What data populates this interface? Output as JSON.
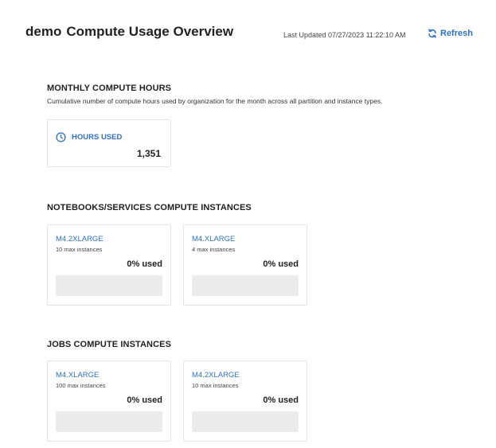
{
  "header": {
    "org": "demo",
    "title": "Compute Usage Overview",
    "last_updated": "Last Updated 07/27/2023 11:22:10 AM",
    "refresh_label": "Refresh"
  },
  "monthly": {
    "title": "MONTHLY COMPUTE HOURS",
    "description": "Cumulative number of compute hours used by organization for the month across all partition and instance types.",
    "hours_label": "HOURS USED",
    "hours_value": "1,351"
  },
  "notebooks": {
    "title": "NOTEBOOKS/SERVICES COMPUTE INSTANCES",
    "instances": [
      {
        "name": "M4.2XLARGE",
        "max": "10 max instances",
        "used": "0% used",
        "used_fraction": 0
      },
      {
        "name": "M4.XLARGE",
        "max": "4 max instances",
        "used": "0% used",
        "used_fraction": 0
      }
    ]
  },
  "jobs": {
    "title": "JOBS COMPUTE INSTANCES",
    "instances": [
      {
        "name": "M4.XLARGE",
        "max": "100 max instances",
        "used": "0% used",
        "used_fraction": 0
      },
      {
        "name": "M4.2XLARGE",
        "max": "10 max instances",
        "used": "0% used",
        "used_fraction": 0
      }
    ]
  },
  "colors": {
    "accent": "#2f72c4",
    "bar_track": "#ebebeb",
    "card_border": "#e3e3e3"
  },
  "icons": {
    "clock": "clock-icon",
    "refresh": "refresh-icon"
  }
}
